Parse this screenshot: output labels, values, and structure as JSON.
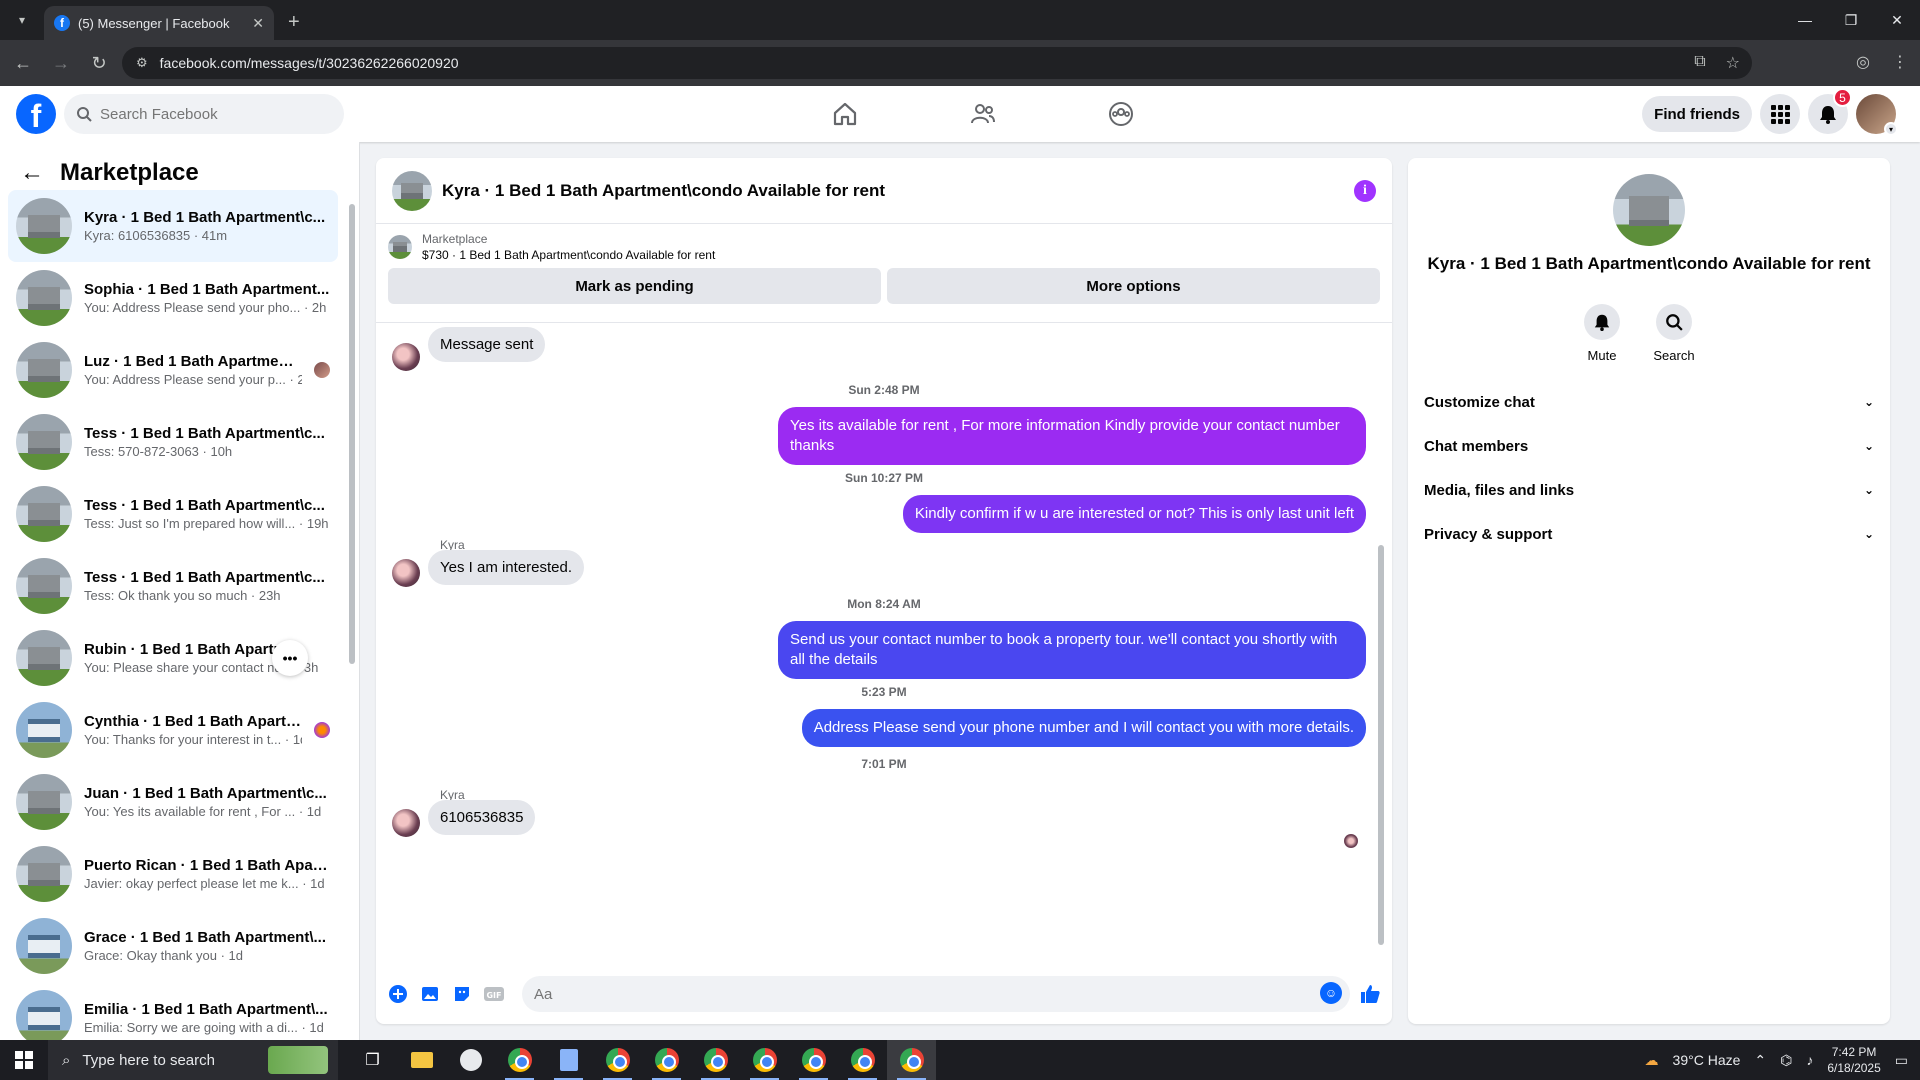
{
  "browser": {
    "tab_title": "(5) Messenger | Facebook",
    "url": "facebook.com/messages/t/30236262266020920"
  },
  "fb": {
    "search_placeholder": "Search Facebook",
    "find_friends": "Find friends",
    "notif_count": "5"
  },
  "sidebar": {
    "title": "Marketplace",
    "conversations": [
      {
        "name": "Kyra · 1 Bed 1 Bath Apartment\\c...",
        "sub": "Kyra: 6106536835 · 41m"
      },
      {
        "name": "Sophia · 1 Bed 1 Bath Apartment...",
        "sub": "You: Address Please send your pho... · 2h"
      },
      {
        "name": "Luz · 1 Bed 1 Bath Apartment\\...",
        "sub": "You: Address Please send your p... · 2h"
      },
      {
        "name": "Tess · 1 Bed 1 Bath Apartment\\c...",
        "sub": "Tess: 570-872-3063 · 10h"
      },
      {
        "name": "Tess · 1 Bed 1 Bath Apartment\\c...",
        "sub": "Tess: Just so I'm prepared how will... · 19h"
      },
      {
        "name": "Tess · 1 Bed 1 Bath Apartment\\c...",
        "sub": "Tess: Ok thank you so much · 23h"
      },
      {
        "name": "Rubin · 1 Bed 1 Bath Apartme...",
        "sub": "You: Please share your contact nu... · 3h"
      },
      {
        "name": "Cynthia · 1 Bed 1 Bath Apartm...",
        "sub": "You: Thanks for your interest in t... · 1d"
      },
      {
        "name": "Juan · 1 Bed 1 Bath Apartment\\c...",
        "sub": "You: Yes its available for rent , For ... · 1d"
      },
      {
        "name": "Puerto Rican · 1 Bed 1 Bath Apar...",
        "sub": "Javier: okay perfect please let me k... · 1d"
      },
      {
        "name": "Grace · 1 Bed 1 Bath Apartment\\...",
        "sub": "Grace: Okay thank you · 1d"
      },
      {
        "name": "Emilia · 1 Bed 1 Bath Apartment\\...",
        "sub": "Emilia: Sorry we are going with a di... · 1d"
      }
    ]
  },
  "chat": {
    "title": "Kyra · 1 Bed 1 Bath Apartment\\condo Available for rent",
    "marketplace_label": "Marketplace",
    "listing": "$730 · 1 Bed 1 Bath Apartment\\condo Available for rent",
    "mark_pending": "Mark as pending",
    "more_options": "More options",
    "messages": {
      "m1": "Message sent",
      "t1": "Sun 2:48 PM",
      "m2": "Yes its  available for rent , For more information Kindly provide your contact number thanks",
      "t2": "Sun 10:27 PM",
      "m3": "Kindly confirm if w u are interested or not? This is only last unit left",
      "s1": "Kyra",
      "m4": "Yes I am interested.",
      "t3": "Mon 8:24 AM",
      "m5": "Send us your contact number to book a property tour. we'll contact you shortly with all the details",
      "t4": "5:23 PM",
      "m6": "Address  Please send your phone number and I will contact you with more details.",
      "t5": "7:01 PM",
      "s2": "Kyra",
      "m7": "6106536835"
    },
    "composer_placeholder": "Aa"
  },
  "info": {
    "title": "Kyra · 1 Bed 1 Bath Apartment\\condo Available for rent",
    "mute": "Mute",
    "search": "Search",
    "menu": [
      "Customize chat",
      "Chat members",
      "Media, files and links",
      "Privacy & support"
    ]
  },
  "taskbar": {
    "search_placeholder": "Type here to search",
    "weather": "39°C  Haze",
    "time": "7:42 PM",
    "date": "6/18/2025"
  }
}
